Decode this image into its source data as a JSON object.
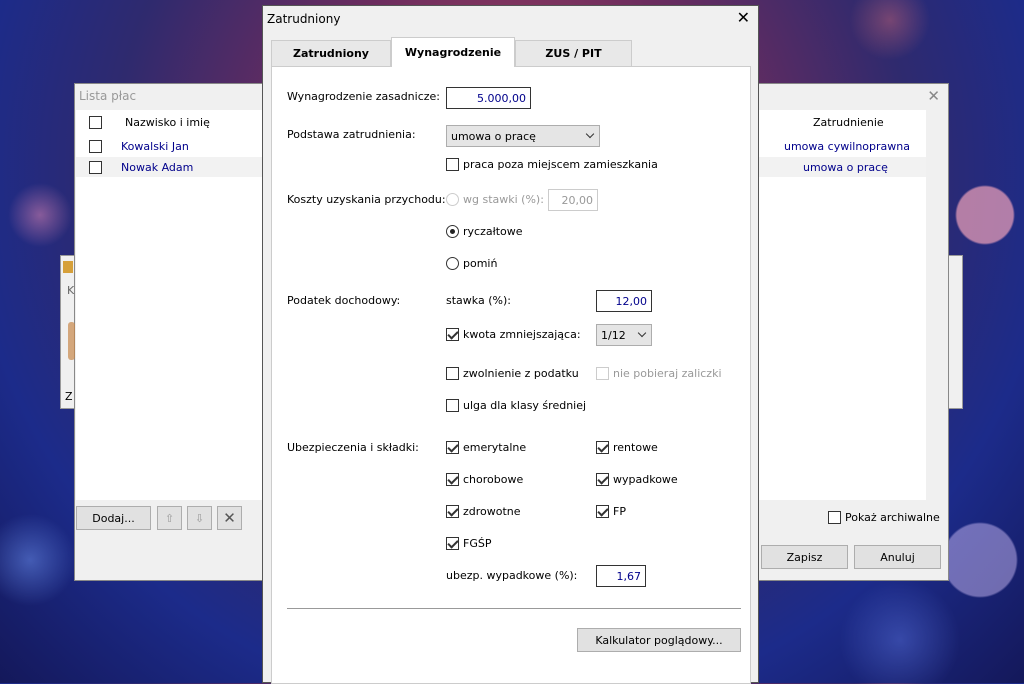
{
  "back_window": {
    "title": "Lista płac",
    "col_name": "Nazwisko i imię",
    "col_employment": "Zatrudnienie",
    "rows": [
      {
        "name": "Kowalski Jan",
        "employment": "umowa cywilnoprawna"
      },
      {
        "name": "Nowak Adam",
        "employment": "umowa o pracę"
      }
    ],
    "add_button": "Dodaj...",
    "show_archived": "Pokaż archiwalne",
    "save_button": "Zapisz",
    "cancel_button": "Anuluj"
  },
  "side_window": {
    "letter_k": "K",
    "letter_z": "Z"
  },
  "dialog": {
    "title": "Zatrudniony",
    "close_glyph": "✕",
    "tabs": [
      {
        "label": "Zatrudniony",
        "active": false
      },
      {
        "label": "Wynagrodzenie",
        "active": true
      },
      {
        "label": "ZUS / PIT",
        "active": false
      }
    ],
    "salary_label": "Wynagrodzenie zasadnicze:",
    "salary_value": "5.000,00",
    "basis_label": "Podstawa zatrudnienia:",
    "basis_value": "umowa o pracę",
    "outside_residence": "praca poza miejscem zamieszkania",
    "costs_label": "Koszty uzyskania przychodu:",
    "costs_rate_label": "wg stawki (%):",
    "costs_rate_value": "20,00",
    "costs_flat": "ryczałtowe",
    "costs_skip": "pomiń",
    "tax_label": "Podatek dochodowy:",
    "tax_rate_label": "stawka (%):",
    "tax_rate_value": "12,00",
    "tax_reduction_label": "kwota zmniejszająca:",
    "tax_reduction_value": "1/12",
    "tax_exempt": "zwolnienie z podatku",
    "no_advance": "nie pobieraj zaliczki",
    "middle_class": "ulga dla klasy średniej",
    "insurance_label": "Ubezpieczenia i składki:",
    "ins_pension": "emerytalne",
    "ins_disability": "rentowe",
    "ins_sickness": "chorobowe",
    "ins_accident": "wypadkowe",
    "ins_health": "zdrowotne",
    "ins_fp": "FP",
    "ins_fgsp": "FGŚP",
    "accident_rate_label": "ubezp. wypadkowe (%):",
    "accident_rate_value": "1,67",
    "calculator_button": "Kalkulator poglądowy..."
  },
  "colors": {
    "link_blue": "#00008b",
    "dialog_bg": "#f0f0f0"
  }
}
